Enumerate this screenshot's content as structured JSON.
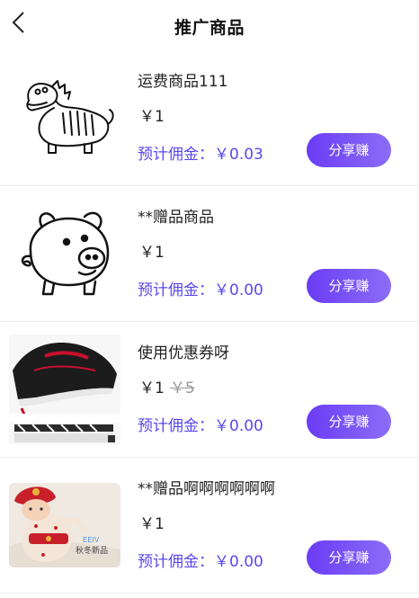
{
  "header": {
    "title": "推广商品",
    "back_icon": "chevron-left-icon"
  },
  "products": [
    {
      "name": "运费商品111",
      "price": "￥1",
      "original_price": "",
      "commission_label": "预计佣金：",
      "commission_value": "￥0.03",
      "share_label": "分享赚",
      "image": "dinosaur-sketch"
    },
    {
      "name": "**赠品商品",
      "price": "￥1",
      "original_price": "",
      "commission_label": "预计佣金：",
      "commission_value": "￥0.00",
      "share_label": "分享赚",
      "image": "pig-sketch"
    },
    {
      "name": "使用优惠券呀",
      "price": "￥1",
      "original_price": "￥5",
      "commission_label": "预计佣金：",
      "commission_value": "￥0.00",
      "share_label": "分享赚",
      "image": "sneaker-photo"
    },
    {
      "name": "**赠品啊啊啊啊啊啊",
      "price": "￥1",
      "original_price": "",
      "commission_label": "预计佣金：",
      "commission_value": "￥0.00",
      "share_label": "分享赚",
      "image": "baby-photo",
      "image_caption": "秋冬新品"
    }
  ],
  "colors": {
    "accent": "#5a47f0",
    "button_gradient_start": "#6a3cf5",
    "button_gradient_end": "#8b6df7",
    "strike_price": "#999999"
  }
}
